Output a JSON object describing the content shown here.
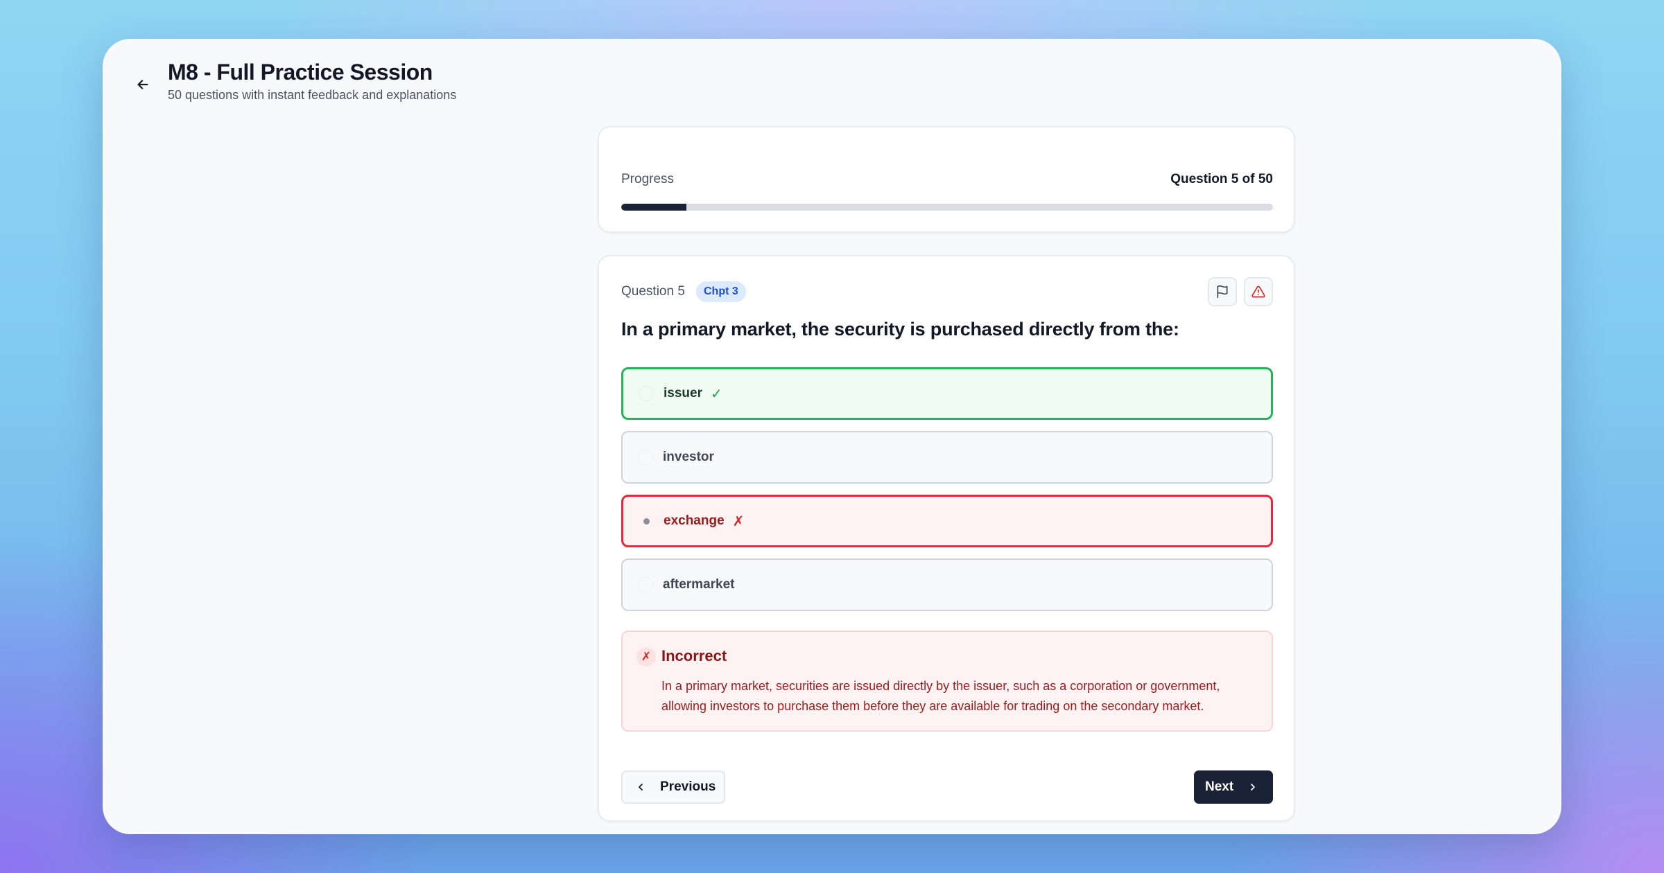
{
  "header": {
    "title": "M8 - Full Practice Session",
    "subtitle": "50 questions with instant feedback and explanations"
  },
  "progress": {
    "label": "Progress",
    "count_text": "Question 5 of 50",
    "fraction": 0.1
  },
  "question": {
    "number_label": "Question 5",
    "chapter_badge": "Chpt 3",
    "text": "In a primary market, the security is purchased directly from the:",
    "options": [
      {
        "label": "issuer",
        "mark": "✓",
        "state": "correct"
      },
      {
        "label": "investor",
        "mark": "",
        "state": "neutral"
      },
      {
        "label": "exchange",
        "mark": "✗",
        "state": "selected-wrong"
      },
      {
        "label": "aftermarket",
        "mark": "",
        "state": "neutral"
      }
    ]
  },
  "feedback": {
    "icon": "✗",
    "title": "Incorrect",
    "text": "In a primary market, securities are issued directly by the issuer, such as a corporation or government, allowing investors to purchase them before they are available for trading on the secondary market."
  },
  "nav": {
    "previous_label": "Previous",
    "next_label": "Next"
  },
  "icons": {
    "back": "arrow-left-icon",
    "flag": "flag-icon",
    "report": "alert-triangle-icon",
    "prev": "chevron-left-icon",
    "next": "chevron-right-icon"
  },
  "colors": {
    "correct": "#22b455",
    "wrong": "#e5283a",
    "primary": "#1a2236",
    "badge_bg": "#dbeafe",
    "badge_text": "#1d4ed8"
  }
}
